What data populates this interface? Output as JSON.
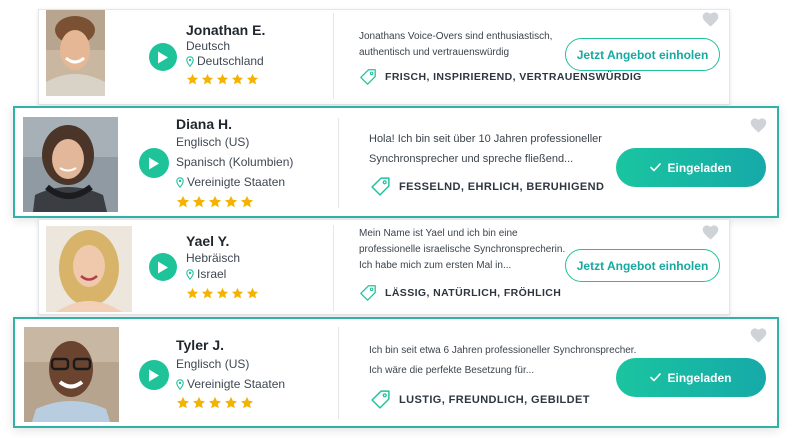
{
  "colors": {
    "accent": "#1ec39a",
    "highlight_border": "#2fb3a4",
    "star": "#f5b301",
    "heart": "#cfd3d7"
  },
  "icons": {
    "play": "play-icon",
    "location": "location-pin-icon",
    "star": "star-icon",
    "tag": "tag-icon",
    "check": "check-icon",
    "favorite": "heart-icon"
  },
  "artists": [
    {
      "name": "Jonathan E.",
      "languages": [
        "Deutsch"
      ],
      "location": "Deutschland",
      "rating": 5,
      "description": [
        "Jonathans Voice-Overs sind enthusiastisch,",
        "authentisch und vertrauenswürdig"
      ],
      "tags": "FRISCH, INSPIRIEREND, VERTRAUENSWÜRDIG",
      "action_label": "Jetzt Angebot einholen",
      "invited": false
    },
    {
      "name": "Diana H.",
      "languages": [
        "Englisch (US)",
        "Spanisch (Kolumbien)"
      ],
      "location": "Vereinigte Staaten",
      "rating": 5,
      "description": [
        "Hola! Ich bin seit über 10 Jahren professioneller",
        "Synchronsprecher und spreche fließend..."
      ],
      "tags": "FESSELND, EHRLICH, BERUHIGEND",
      "action_label": "Eingeladen",
      "invited": true
    },
    {
      "name": "Yael Y.",
      "languages": [
        "Hebräisch"
      ],
      "location": "Israel",
      "rating": 5,
      "description": [
        "Mein Name ist Yael und ich bin eine",
        "professionelle israelische Synchronsprecherin.",
        "Ich habe mich zum ersten Mal in..."
      ],
      "tags": "LÄSSIG, NATÜRLICH, FRÖHLICH",
      "action_label": "Jetzt Angebot einholen",
      "invited": false
    },
    {
      "name": "Tyler J.",
      "languages": [
        "Englisch (US)"
      ],
      "location": "Vereinigte Staaten",
      "rating": 5,
      "description": [
        "Ich bin seit etwa 6 Jahren professioneller Synchronsprecher.",
        "Ich wäre die perfekte Besetzung für..."
      ],
      "tags": "LUSTIG, FREUNDLICH, GEBILDET",
      "action_label": "Eingeladen",
      "invited": true
    }
  ]
}
